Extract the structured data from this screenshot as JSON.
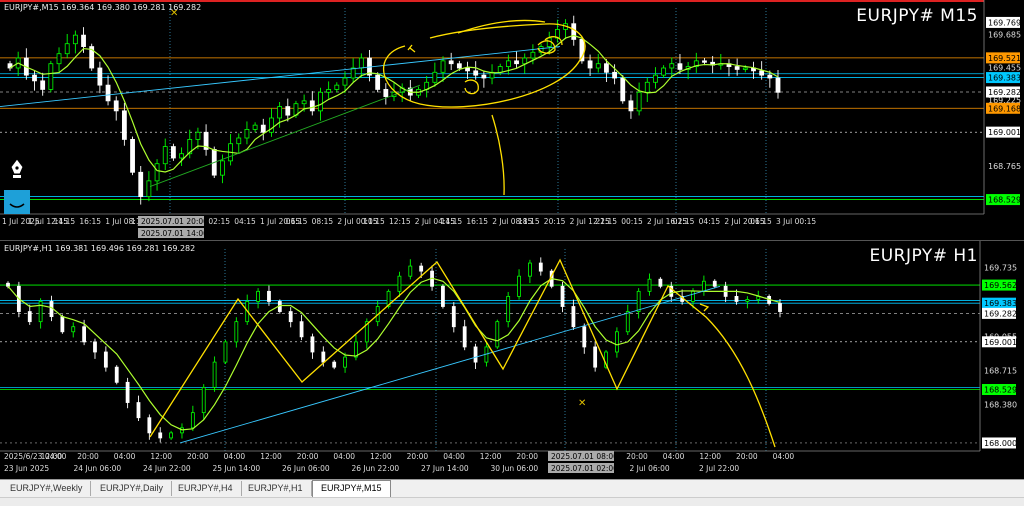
{
  "panes": {
    "m15": {
      "info": "EURJPY#,M15  169.364 169.380 169.281 169.282",
      "title": "EURJPY# M15",
      "price_labels": [
        {
          "text": "169.769",
          "bg": "#ffffff",
          "fg": "#000000"
        },
        {
          "text": "169.685",
          "bg": "",
          "fg": "#dddddd"
        },
        {
          "text": "169.521",
          "bg": "#ff9800",
          "fg": "#000000"
        },
        {
          "text": "169.455",
          "bg": "",
          "fg": "#dddddd"
        },
        {
          "text": "169.383",
          "bg": "#00c8ff",
          "fg": "#000000"
        },
        {
          "text": "169.282",
          "bg": "#ffffff",
          "fg": "#000000"
        },
        {
          "text": "169.225",
          "bg": "",
          "fg": "#dddddd"
        },
        {
          "text": "169.168",
          "bg": "#ff9800",
          "fg": "#000000"
        },
        {
          "text": "169.001",
          "bg": "#ffffff",
          "fg": "#000000"
        },
        {
          "text": "168.765",
          "bg": "",
          "fg": "#dddddd"
        },
        {
          "text": "168.529",
          "bg": "#00ff00",
          "fg": "#000000"
        }
      ],
      "time_labels": [
        "1 Jul 2025",
        "1 Jul 12:15",
        "14:15",
        "16:15",
        "1 Jul 08:15",
        "1 Jul 16:15",
        "22:15",
        "00:15",
        "02:15",
        "04:15",
        "1 Jul 20:15",
        "06:15",
        "08:15",
        "2 Jul 00:15",
        "10:15",
        "12:15",
        "2 Jul 04:15",
        "14:15",
        "16:15",
        "2 Jul 08:15",
        "18:15",
        "20:15",
        "2 Jul 12:15",
        "22:15",
        "00:15",
        "2 Jul 16:15",
        "02:15",
        "04:15",
        "2 Jul 20:15",
        "06:15",
        "3 Jul 00:15"
      ],
      "cursor_time_top": "2025.07.01 20:00",
      "cursor_time_bottom": "2025.07.01 14:00"
    },
    "h1": {
      "info": "EURJPY#,H1  169.381 169.496 169.281 169.282",
      "title": "EURJPY# H1",
      "price_labels": [
        {
          "text": "169.735",
          "bg": "",
          "fg": "#dddddd"
        },
        {
          "text": "169.562",
          "bg": "#00ff00",
          "fg": "#000000"
        },
        {
          "text": "169.383",
          "bg": "#00c8ff",
          "fg": "#000000"
        },
        {
          "text": "169.282",
          "bg": "#ffffff",
          "fg": "#000000"
        },
        {
          "text": "169.055",
          "bg": "",
          "fg": "#dddddd"
        },
        {
          "text": "169.001",
          "bg": "#ffffff",
          "fg": "#000000"
        },
        {
          "text": "168.715",
          "bg": "",
          "fg": "#dddddd"
        },
        {
          "text": "168.529",
          "bg": "#00ff00",
          "fg": "#000000"
        },
        {
          "text": "168.380",
          "bg": "",
          "fg": "#dddddd"
        },
        {
          "text": "168.000",
          "bg": "#ffffff",
          "fg": "#000000"
        }
      ],
      "time_labels": [
        "23 Jun 2025",
        "24 Jun 06:00",
        "24 Jun 22:00",
        "25 Jun 14:00",
        "26 Jun 06:00",
        "26 Jun 22:00",
        "27 Jun 14:00",
        "30 Jun 06:00",
        "1 Jul 14:00",
        "2 Jul 06:00",
        "2 Jul 22:00"
      ],
      "time_labels_upper": [
        "2025/6/23 04:00",
        "12:00",
        "20:00",
        "04:00",
        "12:00",
        "20:00",
        "04:00",
        "12:00",
        "20:00",
        "04:00",
        "12:00",
        "20:00",
        "04:00",
        "12:00",
        "20:00",
        "04:00",
        "12:00",
        "20:00",
        "04:00",
        "12:00",
        "20:00",
        "04:00"
      ],
      "cursor_time_top": "2025.07.01 08:00",
      "cursor_time_bottom": "2025.07.01 02:00"
    }
  },
  "tabs": [
    "EURJPY#,Weekly",
    "EURJPY#,Daily",
    "EURJPY#,H4",
    "EURJPY#,H1",
    "EURJPY#,M15"
  ],
  "active_tab": "EURJPY#,M15",
  "colors": {
    "bull": "#00ff00",
    "bear": "#ffffff",
    "ma": "#adff2f",
    "drawing": "#ffe000",
    "trend": "#38c8ff",
    "grid": "#5a5a5a"
  },
  "chart_data": [
    {
      "type": "candlestick",
      "title": "EURJPY# M15",
      "ylim": [
        168.47,
        169.8
      ],
      "close_series": [
        169.45,
        169.52,
        169.4,
        169.36,
        169.3,
        169.48,
        169.55,
        169.62,
        169.68,
        169.6,
        169.45,
        169.33,
        169.22,
        169.15,
        168.95,
        168.72,
        168.55,
        168.66,
        168.78,
        168.9,
        168.82,
        168.85,
        168.95,
        169.0,
        168.88,
        168.7,
        168.8,
        168.92,
        168.96,
        169.02,
        169.05,
        169.0,
        169.1,
        169.18,
        169.12,
        169.2,
        169.22,
        169.15,
        169.28,
        169.3,
        169.33,
        169.38,
        169.45,
        169.52,
        169.4,
        169.3,
        169.25,
        169.28,
        169.31,
        169.26,
        169.3,
        169.35,
        169.42,
        169.5,
        169.48,
        169.45,
        169.43,
        169.4,
        169.38,
        169.42,
        169.46,
        169.5,
        169.48,
        169.52,
        169.56,
        169.6,
        169.66,
        169.72,
        169.76,
        169.65,
        169.5,
        169.45,
        169.48,
        169.42,
        169.38,
        169.22,
        169.15,
        169.28,
        169.35,
        169.4,
        169.45,
        169.48,
        169.44,
        169.46,
        169.5,
        169.49,
        169.47,
        169.48,
        169.46,
        169.44,
        169.45,
        169.43,
        169.4,
        169.38,
        169.28
      ]
    },
    {
      "type": "candlestick",
      "title": "EURJPY# H1",
      "ylim": [
        167.98,
        169.82
      ],
      "close_series": [
        169.55,
        169.3,
        169.2,
        169.4,
        169.25,
        169.1,
        169.15,
        169.0,
        168.9,
        168.75,
        168.6,
        168.4,
        168.25,
        168.1,
        168.05,
        168.1,
        168.15,
        168.3,
        168.55,
        168.8,
        169.0,
        169.2,
        169.4,
        169.5,
        169.4,
        169.3,
        169.2,
        169.05,
        168.9,
        168.8,
        168.75,
        168.85,
        169.0,
        169.2,
        169.35,
        169.5,
        169.65,
        169.75,
        169.7,
        169.55,
        169.35,
        169.15,
        168.95,
        168.8,
        168.95,
        169.2,
        169.45,
        169.65,
        169.78,
        169.7,
        169.55,
        169.35,
        169.15,
        168.95,
        168.75,
        168.9,
        169.1,
        169.3,
        169.5,
        169.62,
        169.55,
        169.45,
        169.4,
        169.5,
        169.6,
        169.55,
        169.45,
        169.4,
        169.42,
        169.45,
        169.38,
        169.3
      ]
    }
  ]
}
